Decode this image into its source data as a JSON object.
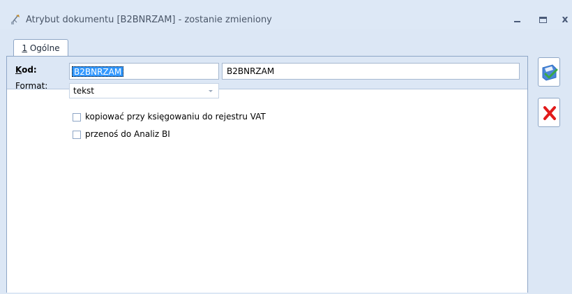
{
  "window": {
    "title": "Atrybut dokumentu [B2BNRZAM] - zostanie zmieniony",
    "icon": "document-attribute-icon",
    "controls": {
      "minimize": "minimize-icon",
      "maximize": "maximize-icon",
      "close": "x"
    }
  },
  "tabs": [
    {
      "accesskey": "1",
      "label": " Ogólne",
      "active": true
    }
  ],
  "form": {
    "code": {
      "label_key": "K",
      "label_rest": "od:",
      "value": "B2BNRZAM",
      "name_value": "B2BNRZAM"
    },
    "format": {
      "label": "Format:",
      "value": "tekst"
    },
    "checkboxes": [
      {
        "label": "kopiować przy księgowaniu do rejestru VAT",
        "checked": false
      },
      {
        "label": "przenoś do Analiz BI",
        "checked": false
      }
    ]
  },
  "actions": {
    "save": "save-icon",
    "cancel": "cancel-icon"
  },
  "colors": {
    "window_bg": "#dce7f5",
    "border": "#8ea6c6",
    "selection": "#3399ff",
    "cancel_red": "#e21b1b",
    "save_blue": "#2f6fc4",
    "save_green": "#3aa845"
  }
}
